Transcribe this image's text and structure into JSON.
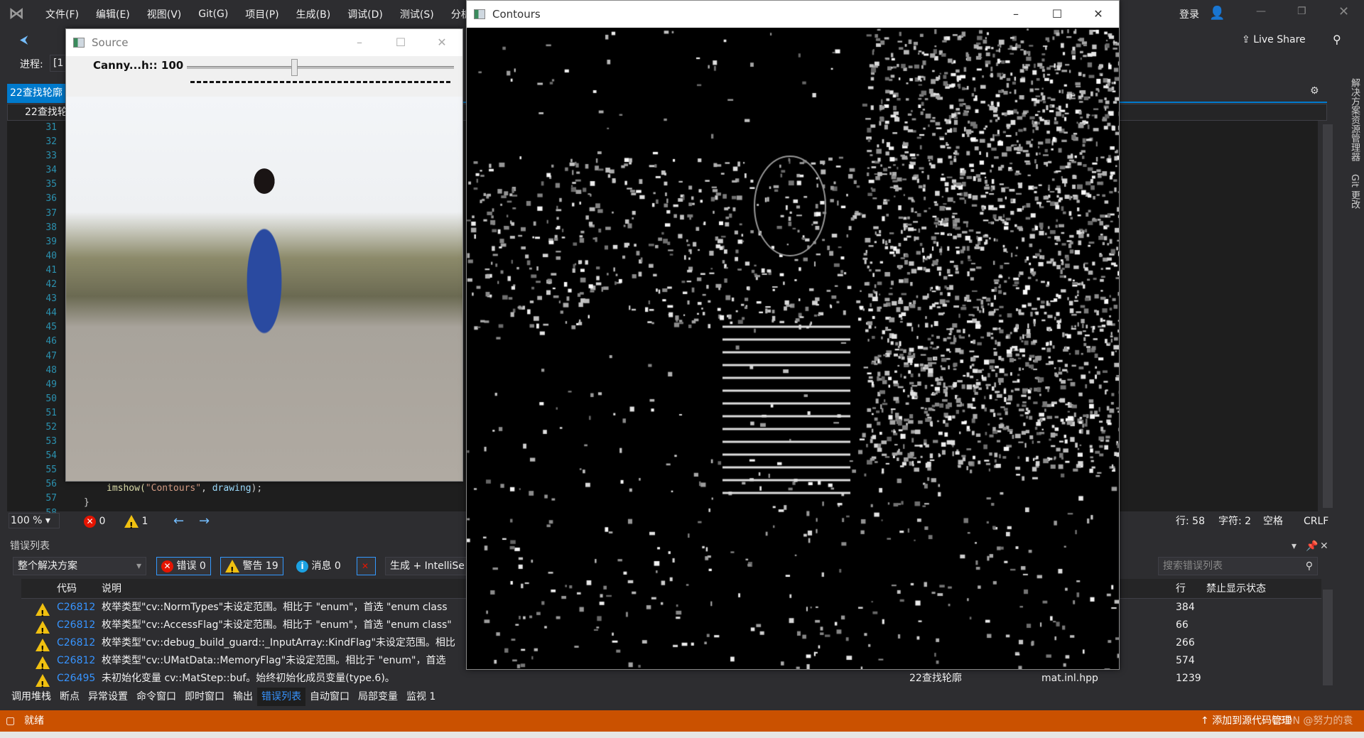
{
  "menu": [
    "文件(F)",
    "编辑(E)",
    "视图(V)",
    "Git(G)",
    "项目(P)",
    "生成(B)",
    "调试(D)",
    "测试(S)",
    "分析"
  ],
  "account": {
    "login": "登录",
    "live_share": "Live Share"
  },
  "toolbar": {
    "process_label": "进程:",
    "process_value": "[1"
  },
  "doc_tab": "22查找轮廓",
  "nav_project": "22查找轮廓",
  "line_numbers": [
    "31",
    "32",
    "33",
    "34",
    "35",
    "36",
    "37",
    "38",
    "39",
    "40",
    "41",
    "42",
    "43",
    "44",
    "45",
    "46",
    "47",
    "48",
    "49",
    "50",
    "51",
    "52",
    "53",
    "54",
    "55",
    "56",
    "57",
    "58"
  ],
  "code": {
    "fn": "imshow(",
    "str": "\"Contours\"",
    "sep": ", ",
    "arg": "drawing",
    "end": ");",
    "brace": "}"
  },
  "editor_status": {
    "zoom": "100 %",
    "errors": "0",
    "warnings": "1",
    "line": "行: 58",
    "char": "字符: 2",
    "spaces": "空格",
    "eol": "CRLF"
  },
  "error_list": {
    "title": "错误列表",
    "scope": "整个解决方案",
    "errors_btn": "错误 0",
    "warnings_btn": "警告 19",
    "messages_btn": "消息 0",
    "build_filter": "生成 + IntelliSe",
    "search_placeholder": "搜索错误列表",
    "columns": {
      "code": "代码",
      "desc": "说明",
      "line": "行",
      "suppress": "禁止显示状态"
    },
    "rows": [
      {
        "code": "C26812",
        "desc": "枚举类型\"cv::NormTypes\"未设定范围。相比于 \"enum\"，首选 \"enum class",
        "line": "384"
      },
      {
        "code": "C26812",
        "desc": "枚举类型\"cv::AccessFlag\"未设定范围。相比于 \"enum\"，首选 \"enum class\"",
        "line": "66"
      },
      {
        "code": "C26812",
        "desc": "枚举类型\"cv::debug_build_guard::_InputArray::KindFlag\"未设定范围。相比",
        "line": "266"
      },
      {
        "code": "C26812",
        "desc": "枚举类型\"cv::UMatData::MemoryFlag\"未设定范围。相比于 \"enum\"，首选",
        "line": "574"
      },
      {
        "code": "C26495",
        "desc": "未初始化变量 cv::MatStep::buf。始终初始化成员变量(type.6)。",
        "line": "1239",
        "project": "22查找轮廓",
        "file": "mat.inl.hpp"
      }
    ]
  },
  "bottom_tabs": [
    "调用堆栈",
    "断点",
    "异常设置",
    "命令窗口",
    "即时窗口",
    "输出",
    "错误列表",
    "自动窗口",
    "局部变量",
    "监视 1"
  ],
  "status": {
    "ready": "就绪",
    "source_control": "添加到源代码管理",
    "watermark": "CSDN @努力的袁"
  },
  "side_tabs": [
    "解决方案资源管理器",
    "Git 更改"
  ],
  "source_window": {
    "title": "Source",
    "trackbar_label": "Canny...h:: 100",
    "trackbar_value": 100,
    "trackbar_max": 255
  },
  "contours_window": {
    "title": "Contours"
  },
  "colors": {
    "accent": "#007acc",
    "status": "#ca5100",
    "warning": "#f0c010",
    "error": "#e51400"
  }
}
